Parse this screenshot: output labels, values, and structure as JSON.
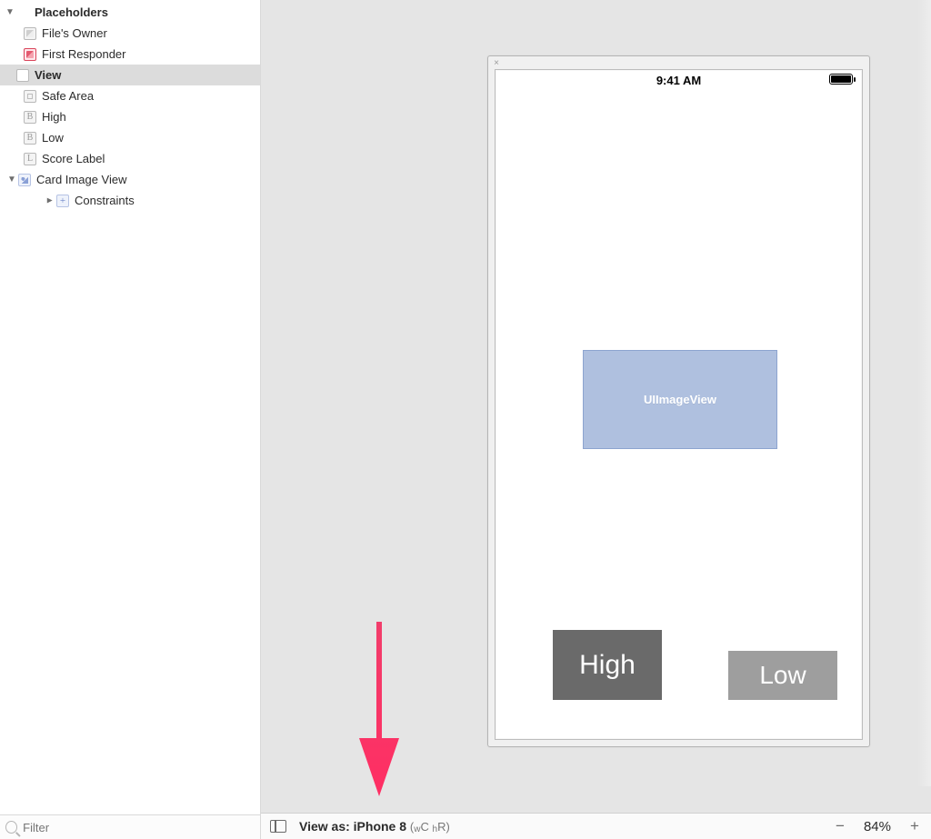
{
  "outline": {
    "placeholders_header": "Placeholders",
    "files_owner": "File's Owner",
    "first_responder": "First Responder",
    "view_header": "View",
    "safe_area": "Safe Area",
    "high": "High",
    "low": "Low",
    "score_label": "Score Label",
    "card_image_view": "Card Image View",
    "constraints": "Constraints"
  },
  "filter": {
    "placeholder": "Filter"
  },
  "device": {
    "statusbar_time": "9:41 AM",
    "uiimage_text": "UIImageView",
    "high_button": "High",
    "low_button": "Low"
  },
  "bottombar": {
    "viewas_prefix": "View as: ",
    "device_name": "iPhone 8",
    "sizeclass_open": "(",
    "sizeclass_w_sub": "w",
    "sizeclass_w": "C ",
    "sizeclass_h_sub": "h",
    "sizeclass_h": "R",
    "sizeclass_close": ")",
    "zoom_pct": "84%"
  }
}
